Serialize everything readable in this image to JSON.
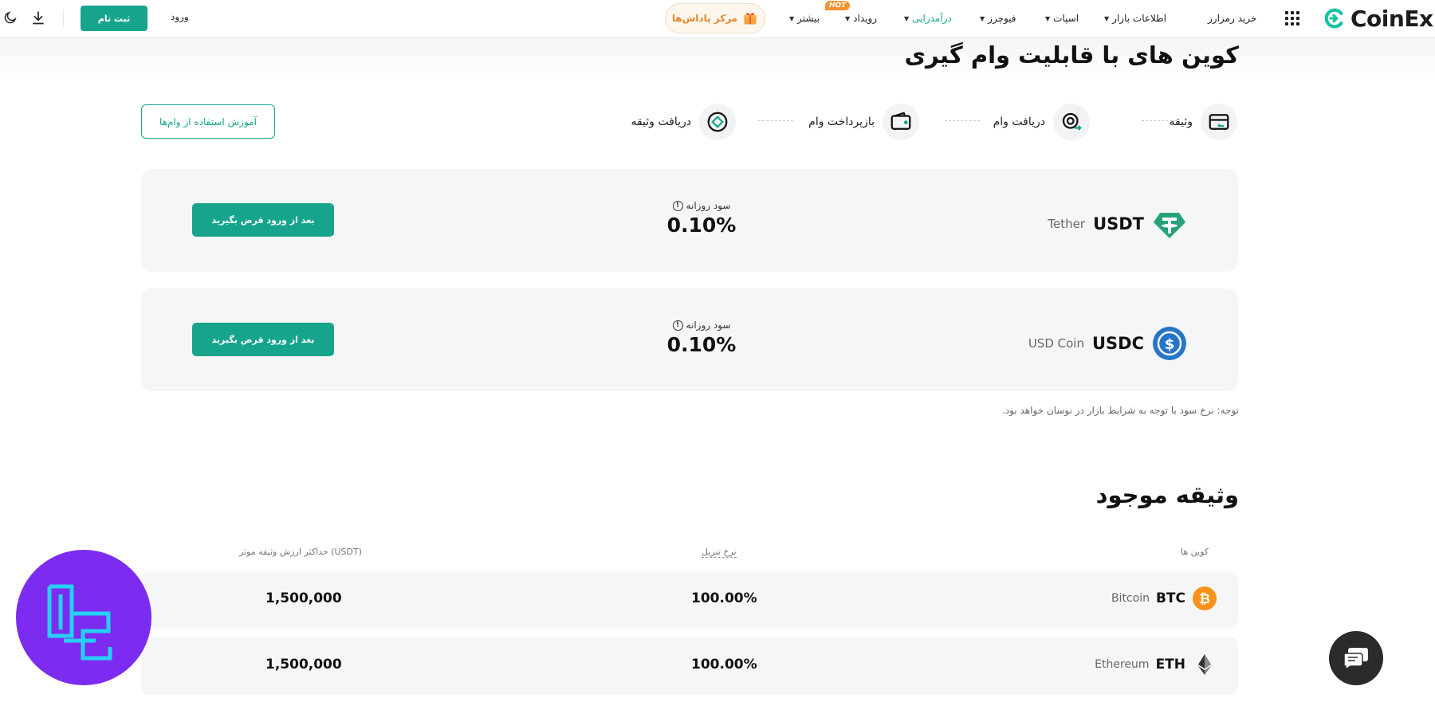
{
  "header": {
    "logo_text": "CoinEx",
    "nav": [
      {
        "label": "خرید رمزارز",
        "caret": false
      },
      {
        "label": "اطلاعات بازار",
        "caret": true
      },
      {
        "label": "اسپات",
        "caret": true
      },
      {
        "label": "فیوچرز",
        "caret": true
      },
      {
        "label": "درآمدزایی",
        "caret": true,
        "active": true
      },
      {
        "label": "رویداد",
        "caret": true,
        "badge": "HOT"
      },
      {
        "label": "بیشتر",
        "caret": true
      }
    ],
    "reward_label": "مرکز پاداش‌ها",
    "login_label": "ورود",
    "signup_label": "ثبت نام",
    "accent_color": "#16a58c"
  },
  "loans": {
    "title": "کوین های با قابلیت وام گیری",
    "steps": [
      "وثیقه",
      "دریافت وام",
      "بازپرداخت وام",
      "دریافت وثیقه"
    ],
    "guide_button": "آموزش استفاده از وام‌ها",
    "cards": [
      {
        "symbol": "USDT",
        "name": "Tether",
        "rate_label": "سود روزانه",
        "rate": "0.10%",
        "button": "بعد از ورود قرض بگیرید"
      },
      {
        "symbol": "USDC",
        "name": "USD Coin",
        "rate_label": "سود روزانه",
        "rate": "0.10%",
        "button": "بعد از ورود قرض بگیرید"
      }
    ],
    "note": "توجه: نرخ سود با توجه به شرایط بازار در نوسان خواهد بود."
  },
  "collateral": {
    "title": "وثیقه موجود",
    "headers": {
      "coin": "کوین ها",
      "rate": "نرخ تنزیل",
      "max": "حداکثر ارزش وثیقه موثر (USDT)"
    },
    "rows": [
      {
        "symbol": "BTC",
        "name": "Bitcoin",
        "rate": "100.00%",
        "max": "1,500,000"
      },
      {
        "symbol": "ETH",
        "name": "Ethereum",
        "rate": "100.00%",
        "max": "1,500,000"
      }
    ]
  }
}
